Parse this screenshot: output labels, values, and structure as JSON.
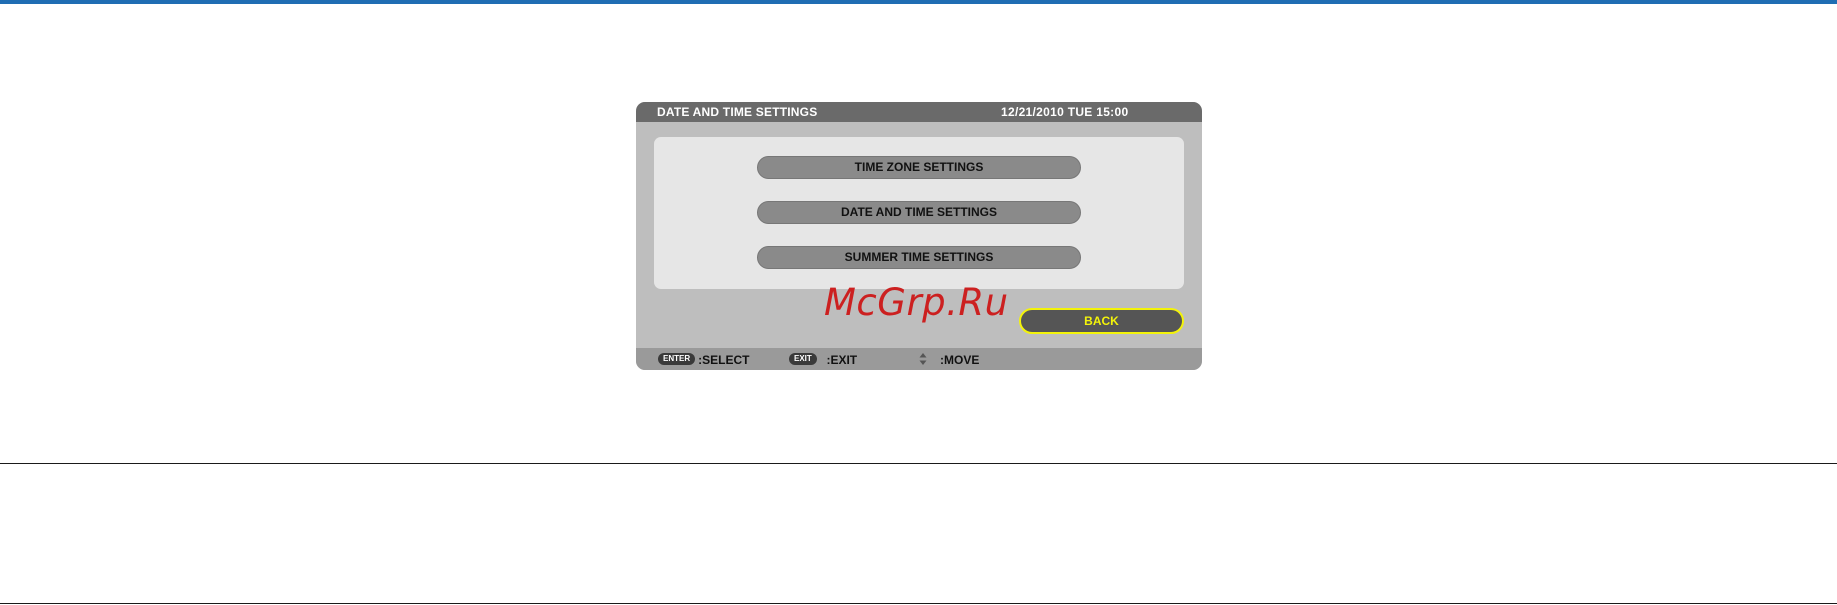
{
  "osd": {
    "title": "DATE AND TIME SETTINGS",
    "datetime": "12/21/2010 TUE 15:00",
    "menu": [
      {
        "label": "TIME ZONE SETTINGS"
      },
      {
        "label": "DATE AND TIME SETTINGS"
      },
      {
        "label": "SUMMER TIME SETTINGS"
      }
    ],
    "back_label": "BACK",
    "footer": {
      "enter_key": "ENTER",
      "enter_action": ":SELECT",
      "exit_key": "EXIT",
      "exit_action": ":EXIT",
      "move_action": ":MOVE",
      "move_icon": "up-down-arrow-icon"
    }
  },
  "watermark": "McGrp.Ru",
  "colors": {
    "accent_rule": "#1f6db3",
    "title_bar": "#6a6a6a",
    "window": "#bebebe",
    "panel": "#e6e6e6",
    "button": "#8a8a8a",
    "back_button": "#555555",
    "focus_highlight": "#f3f30a",
    "watermark": "#cc2020"
  }
}
